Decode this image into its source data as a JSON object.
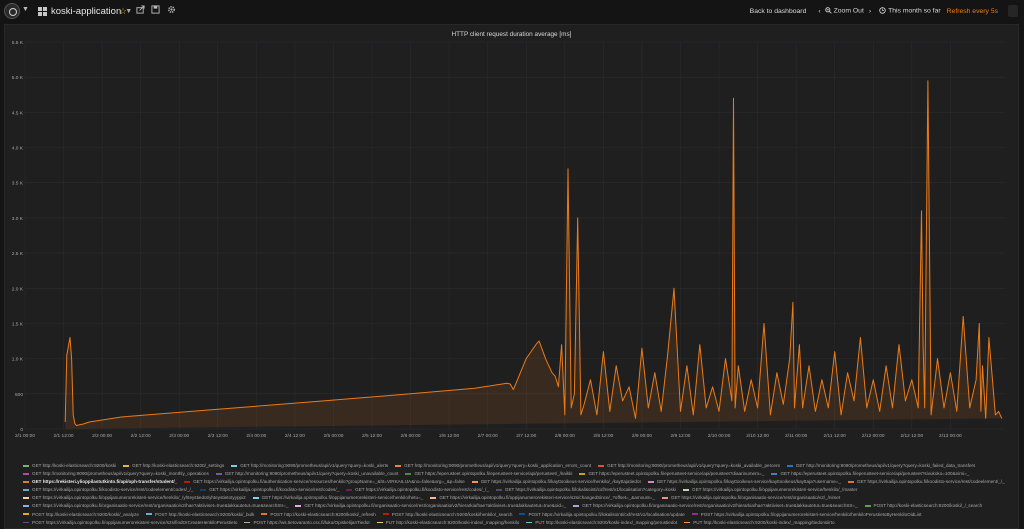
{
  "topbar": {
    "dashboard_title": "koski-application",
    "back_label": "Back to dashboard",
    "zoom_out_label": "Zoom Out",
    "time_range_label": "This month so far",
    "refresh_label": "Refresh every 5s",
    "colors": {
      "accent": "#eb7b18",
      "star": "#e5a812"
    }
  },
  "icons": [
    "grafana-logo-icon",
    "dashboard-grid-icon",
    "star-icon",
    "share-icon",
    "save-icon",
    "gear-icon",
    "chevron-left-icon",
    "zoom-out-icon",
    "chevron-right-icon",
    "clock-icon"
  ],
  "panel": {
    "title": "HTTP client request duration average [ms]"
  },
  "chart_data": {
    "type": "line",
    "title": "HTTP client request duration average [ms]",
    "xlabel": "",
    "ylabel": "",
    "x_tick_labels": [
      "2/1 00:00",
      "2/1 12:00",
      "2/2 00:00",
      "2/2 12:00",
      "2/3 00:00",
      "2/3 12:00",
      "2/4 00:00",
      "2/4 12:00",
      "2/5 00:00",
      "2/5 12:00",
      "2/6 00:00",
      "2/6 12:00",
      "2/7 00:00",
      "2/7 12:00",
      "2/8 00:00",
      "2/8 12:00",
      "2/9 00:00",
      "2/9 12:00",
      "2/10 00:00",
      "2/10 12:00",
      "2/11 00:00",
      "2/11 12:00",
      "2/12 00:00",
      "2/12 12:00",
      "2/13 00:00"
    ],
    "y_tick_labels": [
      "0",
      "500",
      "1.0 K",
      "1.5 K",
      "2.0 K",
      "2.5 K",
      "3.0 K",
      "3.5 K",
      "4.0 K",
      "4.5 K",
      "5.0 K",
      "5.5 K"
    ],
    "y_ticks": [
      0,
      500,
      1000,
      1500,
      2000,
      2500,
      3000,
      3500,
      4000,
      4500,
      5000,
      5500
    ],
    "ylim": [
      0,
      5500
    ],
    "xlim_hours": [
      0,
      305
    ],
    "grid": true,
    "series": [
      {
        "name": "GET https://rekisteri.ylioppilastutkinto.fi/api/oph-transfer/student/_",
        "color": "#eb7b18",
        "x_hours": [
          12.5,
          13,
          14,
          14.5,
          15,
          15.5,
          16,
          17,
          18,
          20,
          30,
          60,
          90,
          120,
          140,
          150,
          151,
          152,
          156,
          159,
          160,
          162,
          164,
          165,
          166,
          167,
          168,
          169,
          170,
          171,
          172,
          173,
          174,
          176,
          178,
          180,
          182,
          184,
          186,
          188,
          190,
          192,
          194,
          196,
          198,
          200,
          202,
          204,
          206,
          208,
          210,
          212,
          214,
          216,
          218,
          220,
          220.5,
          221,
          222,
          224,
          226,
          228,
          230,
          232,
          234,
          236,
          238,
          239,
          239.5,
          240,
          241,
          242,
          244,
          246,
          248,
          250,
          252,
          254,
          256,
          258,
          260,
          262,
          264,
          266,
          268,
          270,
          272,
          274,
          276,
          278,
          279,
          279.5,
          280,
          281,
          282,
          284,
          286,
          288,
          290,
          292,
          294,
          296,
          297,
          297.5,
          298,
          299,
          300,
          302,
          303,
          304,
          305
        ],
        "y_ms": [
          100,
          1050,
          1300,
          1000,
          200,
          80,
          50,
          60,
          70,
          100,
          170,
          280,
          390,
          500,
          580,
          650,
          640,
          560,
          1000,
          1200,
          1250,
          1000,
          800,
          750,
          600,
          1200,
          200,
          3700,
          300,
          500,
          3000,
          200,
          350,
          700,
          200,
          1100,
          250,
          900,
          400,
          600,
          150,
          1150,
          300,
          800,
          250,
          1050,
          2000,
          250,
          900,
          200,
          1200,
          300,
          600,
          250,
          1000,
          400,
          4700,
          300,
          900,
          250,
          700,
          300,
          1500,
          200,
          800,
          350,
          1000,
          1800,
          300,
          600,
          1200,
          300,
          900,
          250,
          700,
          300,
          1100,
          200,
          800,
          400,
          1300,
          300,
          700,
          250,
          900,
          300,
          1200,
          400,
          700,
          300,
          3100,
          1200,
          300,
          4950,
          200,
          1000,
          300,
          800,
          250,
          1600,
          300,
          700,
          1500,
          250,
          900,
          150,
          1300,
          200,
          250,
          150
        ]
      }
    ],
    "legend": [
      {
        "label": "GET http://koski-elasticsearch:9200/koski",
        "color": "#7eb26d"
      },
      {
        "label": "GET http://koski-elasticsearch:9200/_settings",
        "color": "#eab839"
      },
      {
        "label": "GET http://monitoring:9090/prometheus/api/v1/query?query=koski_alerts",
        "color": "#6ed0e0"
      },
      {
        "label": "GET http://monitoring:9090/prometheus/api/v1/query?query=koski_application_errors_count",
        "color": "#ef843c"
      },
      {
        "label": "GET http://monitoring:9090/prometheus/api/v1/query?query=koski_available_percent",
        "color": "#e24d42"
      },
      {
        "label": "GET http://monitoring:9090/prometheus/api/v1/query?query=koski_failed_data_transfers",
        "color": "#1f78c1"
      },
      {
        "label": "GET http://monitoring:9090/prometheus/api/v1/query?query=koski_monthly_operations",
        "color": "#ba43a9"
      },
      {
        "label": "GET http://monitoring:9090/prometheus/api/v1/query?query=koski_unavailable_count",
        "color": "#705da0"
      },
      {
        "label": "GET https://eperusteet.opintopolku.fi/eperusteet-service/api/perusteet/_/kaikki",
        "color": "#508642"
      },
      {
        "label": "GET https://eperusteet.opintopolku.fi/eperusteet-service/api/perusteet?diaarinumero=_",
        "color": "#cca300"
      },
      {
        "label": "GET https://eperusteet.opintopolku.fi/eperusteet-service/api/perusteet?sivukoko=100&nimi=_",
        "color": "#447ebc"
      },
      {
        "label": "GET https://rekisteri.ylioppilastutkinto.fi/api/oph-transfer/student/_",
        "color": "#eb7b18"
      },
      {
        "label": "GET https://virkailija.opintopolku.fi/authentication-service/resources/henkilo?groupName=_&ht=VIRKAILIJA&no=false&org=_&p=false",
        "color": "#bf1b00"
      },
      {
        "label": "GET https://virkailija.opintopolku.fi/kayttooikeus-service/henkilo/_/kayttajatiedot",
        "color": "#f9934e"
      },
      {
        "label": "GET https://virkailija.opintopolku.fi/kayttooikeus-service/kayttooikeus/kayttaja?username=_",
        "color": "#d683ce"
      },
      {
        "label": "GET https://virkailija.opintopolku.fi/koodisto-service/rest/codeelement/_/_",
        "color": "#e0752d"
      },
      {
        "label": "GET https://virkailija.opintopolku.fi/koodisto-service/rest/codeelement/codes/_/_",
        "color": "#64b0c8"
      },
      {
        "label": "GET https://virkailija.opintopolku.fi/koodisto-service/rest/codes/_",
        "color": "#0a437c"
      },
      {
        "label": "GET https://virkailija.opintopolku.fi/koodisto-service/rest/codes/_/_",
        "color": "#6d1f62"
      },
      {
        "label": "GET https://virkailija.opintopolku.fi/lokalisointi/cxf/rest/v1/localisation?category=koski",
        "color": "#584477"
      },
      {
        "label": "GET https://virkailija.opintopolku.fi/oppijanumerorekisteri-service/henkilo/_/master",
        "color": "#b7dbab"
      },
      {
        "label": "GET https://virkailija.opintopolku.fi/oppijanumerorekisteri-service/henkilo/_/yhteystiedot/yhteystietotyyppi2",
        "color": "#f4d598"
      },
      {
        "label": "GET https://virkailija.opintopolku.fi/oppijanumerorekisteri-service/henkilo/hetu=_",
        "color": "#70dbed"
      },
      {
        "label": "GET https://virkailija.opintopolku.fi/oppijanumerorekisteri-service/s2s/changedSince/_?offset=_&amount=_",
        "color": "#f9ba8f"
      },
      {
        "label": "GET https://virkailija.opintopolku.fi/organisaatio-service/rest/organisaatio/v2/_/nimet",
        "color": "#f29191"
      },
      {
        "label": "GET https://virkailija.opintopolku.fi/organisaatio-service/rest/organisaatio/v2/hae?aktiiviset=true&lakkautetut=true&searchStr=_",
        "color": "#82b5d8"
      },
      {
        "label": "GET https://virkailija.opintopolku.fi/organisaatio-service/rest/organisaatio/v2/hierarkia/hae?aktiiviset=true&lakkautetut=true&oid=_",
        "color": "#e5a8e2"
      },
      {
        "label": "GET https://virkailija.opintopolku.fi/organisaatio-service/rest/organisaatio/v2/hierarkia/hae?aktiiviset=true&lakkautetut=true&searchStr=_",
        "color": "#aea2e0"
      },
      {
        "label": "POST http://koski-elasticsearch:9200/koski/_/_search",
        "color": "#629e51"
      },
      {
        "label": "POST http://koski-elasticsearch:9200/koski/_analyze",
        "color": "#e5ac0e"
      },
      {
        "label": "POST http://koski-elasticsearch:9200/koski/_bulk",
        "color": "#64b0c8"
      },
      {
        "label": "POST http://koski-elasticsearch:9200/koski/_refresh",
        "color": "#e0752d"
      },
      {
        "label": "POST http://koski-elasticsearch:9200/koski/henkilo/_search",
        "color": "#bf1b00"
      },
      {
        "label": "POST https://virkailija.opintopolku.fi/lokalisointi/cxf/rest/v1/localisation/update",
        "color": "#0a50a1"
      },
      {
        "label": "POST https://virkailija.opintopolku.fi/oppijanumerorekisteri-service/henkilo/henkiloPerustietoByHenkiloOidList",
        "color": "#962d82"
      },
      {
        "label": "POST https://virkailija.opintopolku.fi/oppijanumerorekisteri-service/s2s/findOrCreateHenkiloPerustieto",
        "color": "#614d93"
      },
      {
        "label": "POST https://ws.tietovaranto.csc.fi/luku/OpiskelijanTiedot",
        "color": "#9ac48a"
      },
      {
        "label": "PUT http://koski-elasticsearch:9200/koski-index/_mapping/henkilo",
        "color": "#f2c96d"
      },
      {
        "label": "PUT http://koski-elasticsearch:9200/koski-index/_mapping/perustiedot",
        "color": "#65c5db"
      },
      {
        "label": "PUT http://koski-elasticsearch:9200/koski-index/_mapping/tiedonsiirto",
        "color": "#f9934e"
      }
    ]
  }
}
